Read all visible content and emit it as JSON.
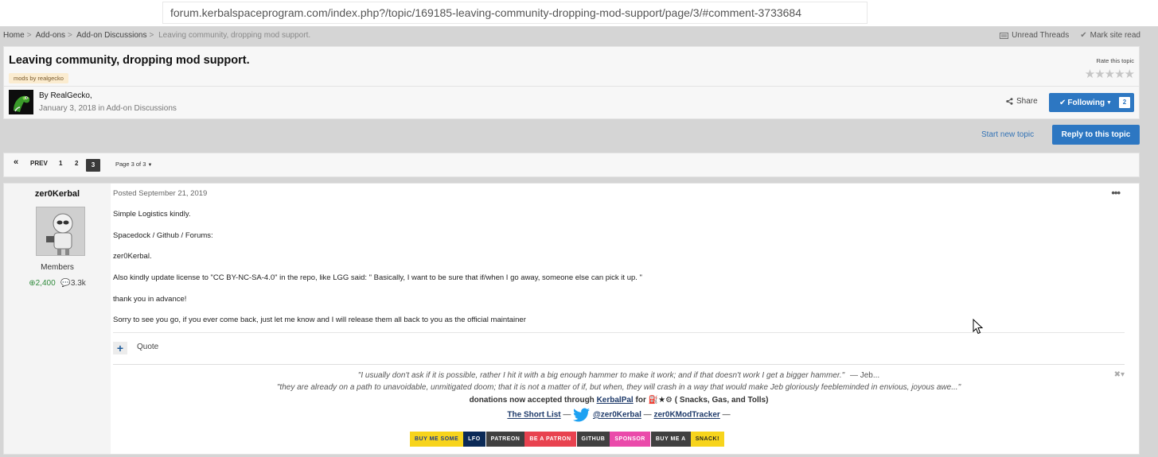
{
  "browser": {
    "url": "forum.kerbalspaceprogram.com/index.php?/topic/169185-leaving-community-dropping-mod-support/page/3/#comment-3733684"
  },
  "breadcrumb": {
    "items": [
      "Home",
      "Add-ons",
      "Add-on Discussions"
    ],
    "separator": ">",
    "current": "Leaving community, dropping mod support."
  },
  "top_links": {
    "unread": "Unread Threads",
    "mark_read": "Mark site read"
  },
  "topic": {
    "title": "Leaving community, dropping mod support.",
    "tag": "mods by realgecko",
    "rate_label": "Rate this topic",
    "rating_stars": 0,
    "by_label": "By RealGecko,",
    "date": "January 3, 2018",
    "in_label": "in",
    "forum": "Add-on Discussions",
    "share_label": "Share",
    "follow_label": "Following",
    "follow_count": "2"
  },
  "actions": {
    "start_new": "Start new topic",
    "reply": "Reply to this topic"
  },
  "pagination": {
    "prev": "PREV",
    "pages": [
      "1",
      "2",
      "3"
    ],
    "current": "3",
    "page_select": "Page 3 of 3"
  },
  "post": {
    "author": "zer0Kerbal",
    "group": "Members",
    "reputation": "2,400",
    "posts": "3.3k",
    "posted": "Posted September 21, 2019",
    "lines": [
      "Simple Logistics kindly.",
      "Spacedock / Github / Forums:",
      "zer0Kerbal.",
      "Also kindly update license to \"CC BY-NC-SA-4.0\" in the repo, like LGG said: \" Basically, I want to be sure that if/when I go away, someone else can pick it up. \"",
      "thank you in advance!",
      "Sorry to see you go, if you ever come back, just let me know and I will release them all back to you as the official maintainer"
    ],
    "quote_label": "Quote"
  },
  "signature": {
    "quote1": "\"I usually don't ask if it is possible, rather I hit it with a big enough hammer to make it work; and if that doesn't work I get a bigger hammer.\"",
    "quote1_attr": "— Jeb...",
    "quote2": "\"they are already on a path to unavoidable, unmitigated doom; that it is not a matter of if, but when, they will crash in a way that would make Jeb gloriously feebleminded in envious, joyous awe...\"",
    "donations_pre": "donations now accepted through",
    "donations_link": "KerbalPal",
    "donations_for": "for",
    "donations_post": "( Snacks, Gas, and Tolls)",
    "short_list": "The Short List",
    "dash": "—",
    "twitter": "@zer0Kerbal",
    "tracker": "zer0KModTracker",
    "badges": [
      {
        "text": "BUY ME SOME",
        "bg": "#f7d41c",
        "fg": "#1e3a8a"
      },
      {
        "text": "LFO",
        "bg": "#0b2a57",
        "fg": "#ffffff"
      },
      {
        "text": "PATREON",
        "bg": "#404040",
        "fg": "#ffffff"
      },
      {
        "text": "BE A PATRON",
        "bg": "#e8424f",
        "fg": "#ffffff"
      },
      {
        "text": "GITHUB",
        "bg": "#404040",
        "fg": "#ffffff"
      },
      {
        "text": "SPONSOR",
        "bg": "#ea4aaa",
        "fg": "#ffffff"
      },
      {
        "text": "BUY ME A",
        "bg": "#404040",
        "fg": "#ffffff"
      },
      {
        "text": "SNACK!",
        "bg": "#f7d41c",
        "fg": "#222222"
      }
    ]
  },
  "colors": {
    "accent": "#2d77c2",
    "reputation": "#2f8a3b",
    "tag_bg": "#fbecd0"
  }
}
